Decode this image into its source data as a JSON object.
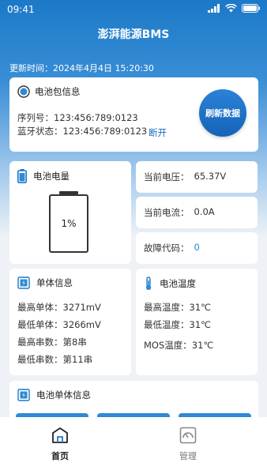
{
  "status": {
    "time": "09:41"
  },
  "app": {
    "title": "澎湃能源BMS"
  },
  "update": {
    "label": "更新时间：",
    "value": "2024年4月4日 15:20:30"
  },
  "pack": {
    "title": "电池包信息",
    "serial_label": "序列号：",
    "serial_value": "123:456:789:0123",
    "bt_label": "蓝牙状态：",
    "bt_value": "123:456:789:0123",
    "disconnect": "断开",
    "refresh": "刷新数据"
  },
  "capacity": {
    "title": "电池电量",
    "percent_text": "1%",
    "percent": 1
  },
  "voltage": {
    "label": "当前电压：",
    "value": "65.37V"
  },
  "current": {
    "label": "当前电流：",
    "value": "0.0A"
  },
  "fault": {
    "label": "故障代码：",
    "value": "0"
  },
  "cell_info": {
    "title": "单体信息",
    "rows": [
      {
        "label": "最高单体：",
        "value": "3271mV"
      },
      {
        "label": "最低单体：",
        "value": "3266mV"
      },
      {
        "label": "最高串数：",
        "value": "第8串"
      },
      {
        "label": "最低串数：",
        "value": "第11串"
      }
    ]
  },
  "temperature": {
    "title": "电池温度",
    "rows": [
      {
        "label": "最高温度：",
        "value": "31℃"
      },
      {
        "label": "最低温度：",
        "value": "31℃"
      },
      {
        "label": "MOS温度：",
        "value": "31℃"
      }
    ]
  },
  "cells": {
    "title": "电池单体信息"
  },
  "tabs": [
    {
      "label": "首页",
      "active": true
    },
    {
      "label": "管理",
      "active": false
    }
  ],
  "colors": {
    "primary": "#1c79c8",
    "accent": "#1b6cc0",
    "battery_fill": "#4fbf6a"
  }
}
